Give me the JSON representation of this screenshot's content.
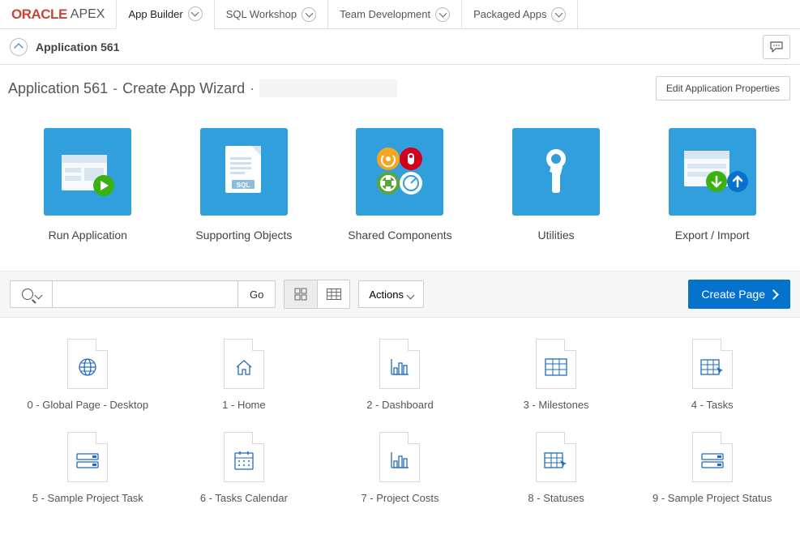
{
  "brand": {
    "oracle": "ORACLE",
    "apex": "APEX"
  },
  "topTabs": [
    {
      "label": "App Builder",
      "active": true
    },
    {
      "label": "SQL Workshop",
      "active": false
    },
    {
      "label": "Team Development",
      "active": false
    },
    {
      "label": "Packaged Apps",
      "active": false
    }
  ],
  "breadcrumb": {
    "label": "Application 561"
  },
  "header": {
    "title_prefix": "Application 561",
    "title_sep": "-",
    "title_name": "Create App Wizard",
    "editButton": "Edit Application Properties"
  },
  "tiles": [
    {
      "label": "Run Application"
    },
    {
      "label": "Supporting Objects"
    },
    {
      "label": "Shared Components"
    },
    {
      "label": "Utilities"
    },
    {
      "label": "Export / Import"
    }
  ],
  "toolbar": {
    "go": "Go",
    "actions": "Actions",
    "createPage": "Create Page",
    "searchValue": ""
  },
  "pages": [
    {
      "num": "0",
      "name": "Global Page - Desktop",
      "icon": "globe"
    },
    {
      "num": "1",
      "name": "Home",
      "icon": "home"
    },
    {
      "num": "2",
      "name": "Dashboard",
      "icon": "chart"
    },
    {
      "num": "3",
      "name": "Milestones",
      "icon": "grid"
    },
    {
      "num": "4",
      "name": "Tasks",
      "icon": "grid-cursor"
    },
    {
      "num": "5",
      "name": "Sample Project Task",
      "icon": "form"
    },
    {
      "num": "6",
      "name": "Tasks Calendar",
      "icon": "calendar"
    },
    {
      "num": "7",
      "name": "Project Costs",
      "icon": "chart"
    },
    {
      "num": "8",
      "name": "Statuses",
      "icon": "grid-cursor"
    },
    {
      "num": "9",
      "name": "Sample Project Status",
      "icon": "form"
    }
  ]
}
